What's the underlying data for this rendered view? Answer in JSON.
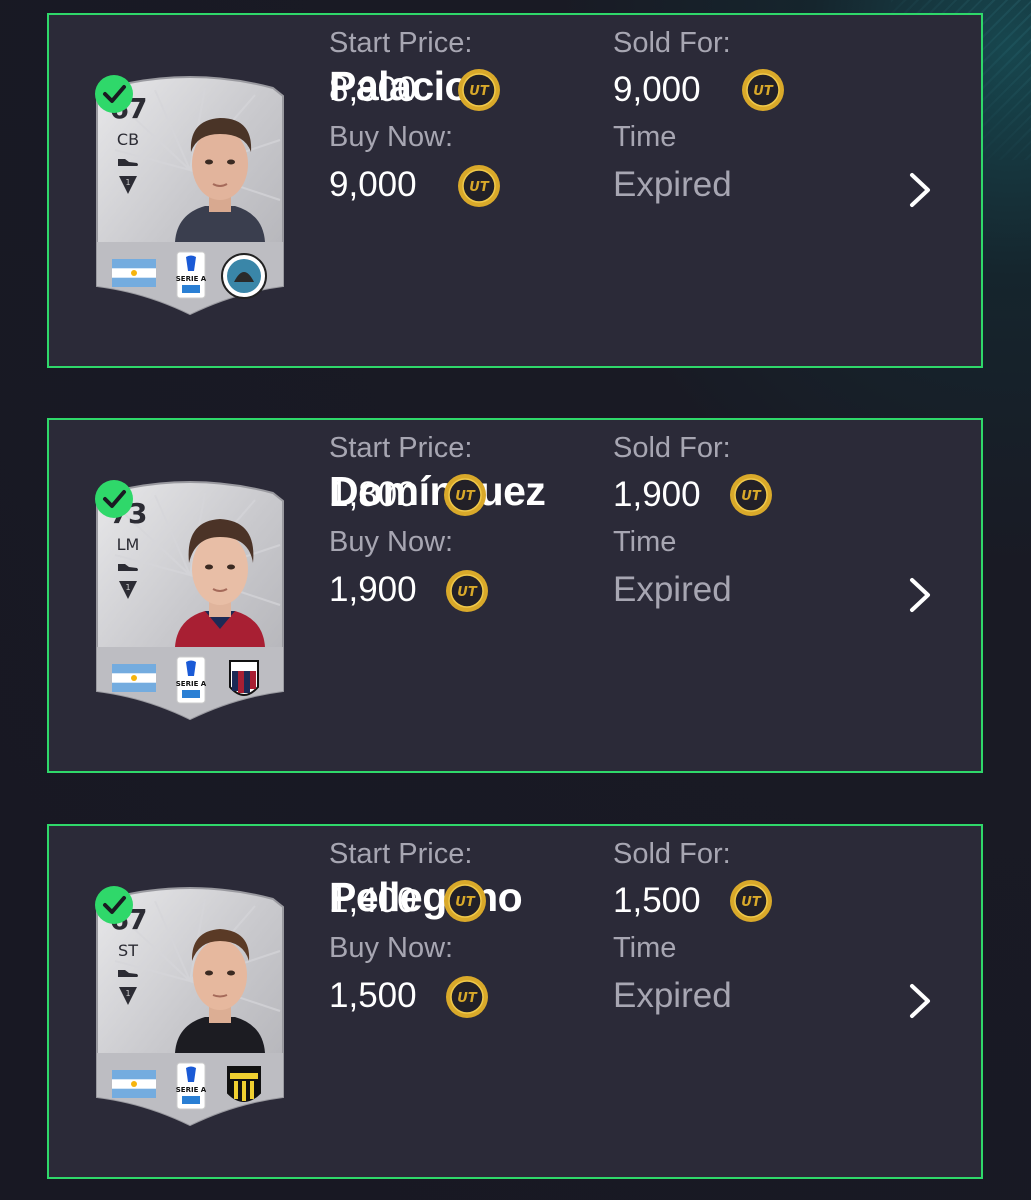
{
  "colors": {
    "accent_border": "#2fd86a",
    "panel": "#2b2a38",
    "coin": "#d9a92a",
    "label": "#a7a6b2"
  },
  "labels": {
    "start_price": "Start Price:",
    "sold_for": "Sold For:",
    "buy_now": "Buy Now:",
    "time": "Time"
  },
  "coin_text": "UT",
  "items": [
    {
      "player_name": "Palacios",
      "rating": "67",
      "position": "CB",
      "start_price": "8,900",
      "sold_for": "9,000",
      "buy_now": "9,000",
      "time": "Expired",
      "nation_flag": "argentina-flag-icon",
      "league_badge": "serie-a-badge-icon",
      "club_badge": "spezia-badge-icon"
    },
    {
      "player_name": "Domínguez",
      "rating": "73",
      "position": "LM",
      "start_price": "1,800",
      "sold_for": "1,900",
      "buy_now": "1,900",
      "time": "Expired",
      "nation_flag": "argentina-flag-icon",
      "league_badge": "serie-a-badge-icon",
      "club_badge": "bologna-badge-icon"
    },
    {
      "player_name": "Pellegrino",
      "rating": "67",
      "position": "ST",
      "start_price": "1,400",
      "sold_for": "1,500",
      "buy_now": "1,500",
      "time": "Expired",
      "nation_flag": "argentina-flag-icon",
      "league_badge": "serie-a-badge-icon",
      "club_badge": "parma-badge-icon"
    }
  ]
}
